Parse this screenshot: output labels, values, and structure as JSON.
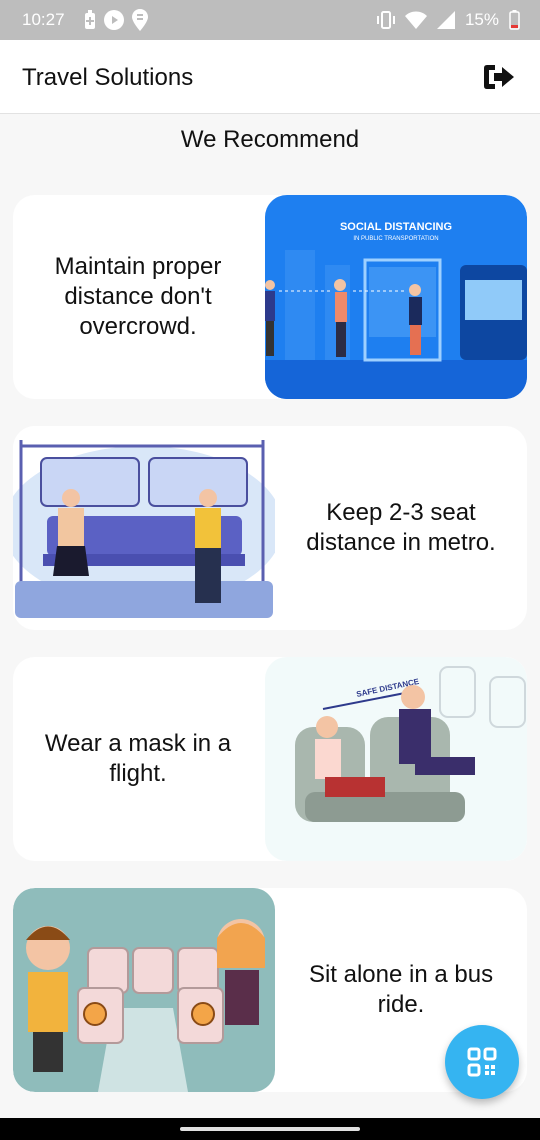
{
  "status_bar": {
    "time": "10:27",
    "battery": "15%"
  },
  "app_bar": {
    "title": "Travel Solutions",
    "logout_icon": "logout-icon"
  },
  "section": {
    "title": "We Recommend"
  },
  "cards": [
    {
      "text": "Maintain proper distance don't overcrowd.",
      "image": "social-distancing-public-transport",
      "image_title": "SOCIAL DISTANCING",
      "image_subtitle": "IN PUBLIC TRANSPORTATION"
    },
    {
      "text": "Keep 2-3 seat distance in metro.",
      "image": "metro-seat-distance"
    },
    {
      "text": "Wear a mask in a flight.",
      "image": "flight-mask",
      "image_label": "SAFE DISTANCE"
    },
    {
      "text": "Sit alone in a bus ride.",
      "image": "bus-sit-alone"
    }
  ],
  "fab": {
    "icon": "qr-code-icon"
  },
  "colors": {
    "accent": "#35b4f1",
    "transport_blue": "#1976e8"
  }
}
